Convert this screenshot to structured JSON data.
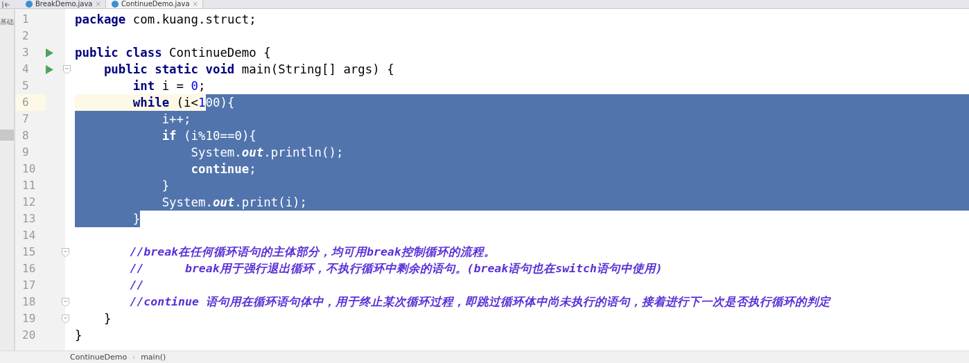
{
  "tabs": [
    {
      "label": "BreakDemo.java",
      "selected": false,
      "close": "×"
    },
    {
      "label": "ContinueDemo.java",
      "selected": true,
      "close": "×"
    }
  ],
  "project_panel": {
    "label": "基础"
  },
  "lines": [
    {
      "number": "1",
      "run": false,
      "fold": false,
      "current": false,
      "selected_to_end": false,
      "tokens": [
        {
          "text": "package",
          "kind": "kw",
          "selected": false
        },
        {
          "text": " com.kuang.struct;",
          "kind": "plain",
          "selected": false
        }
      ]
    },
    {
      "number": "2",
      "run": false,
      "fold": false,
      "current": false,
      "selected_to_end": false
    },
    {
      "number": "3",
      "run": true,
      "fold": false,
      "current": false,
      "selected_to_end": false,
      "tokens": [
        {
          "text": "public class",
          "kind": "kw",
          "selected": false
        },
        {
          "text": " ContinueDemo {",
          "kind": "plain",
          "selected": false
        }
      ]
    },
    {
      "number": "4",
      "run": true,
      "fold": true,
      "current": false,
      "selected_to_end": false,
      "tokens": [
        {
          "text": "    public static void",
          "kind": "kw",
          "selected": false
        },
        {
          "text": " main(String[] args) {",
          "kind": "plain",
          "selected": false
        }
      ]
    },
    {
      "number": "5",
      "run": false,
      "fold": false,
      "current": false,
      "selected_to_end": false,
      "tokens": [
        {
          "text": "        int",
          "kind": "kw",
          "selected": false
        },
        {
          "text": " i = ",
          "kind": "plain",
          "selected": false
        },
        {
          "text": "0",
          "kind": "num",
          "selected": false
        },
        {
          "text": ";",
          "kind": "plain",
          "selected": false
        }
      ]
    },
    {
      "number": "6",
      "run": false,
      "fold": false,
      "current": true,
      "selected_to_end": true,
      "tokens": [
        {
          "text": "        while",
          "kind": "kw",
          "selected": false
        },
        {
          "text": " (i<",
          "kind": "plain",
          "selected": false
        },
        {
          "text": "1",
          "kind": "num",
          "selected": false
        },
        {
          "text": "00",
          "kind": "num",
          "selected": true
        },
        {
          "text": "){",
          "kind": "plain",
          "selected": true
        }
      ]
    },
    {
      "number": "7",
      "run": false,
      "fold": false,
      "current": false,
      "selected_to_end": true,
      "tokens": [
        {
          "text": "            i++;",
          "kind": "plain",
          "selected": true
        }
      ]
    },
    {
      "number": "8",
      "run": false,
      "fold": false,
      "current": false,
      "selected_to_end": true,
      "tokens": [
        {
          "text": "            if",
          "kind": "kw",
          "selected": true
        },
        {
          "text": " (i%",
          "kind": "plain",
          "selected": true
        },
        {
          "text": "10",
          "kind": "num",
          "selected": true
        },
        {
          "text": "==",
          "kind": "plain",
          "selected": true
        },
        {
          "text": "0",
          "kind": "num",
          "selected": true
        },
        {
          "text": "){",
          "kind": "plain",
          "selected": true
        }
      ]
    },
    {
      "number": "9",
      "run": false,
      "fold": false,
      "current": false,
      "selected_to_end": true,
      "tokens": [
        {
          "text": "                System.",
          "kind": "plain",
          "selected": true
        },
        {
          "text": "out",
          "kind": "field",
          "selected": true
        },
        {
          "text": ".println();",
          "kind": "plain",
          "selected": true
        }
      ]
    },
    {
      "number": "10",
      "run": false,
      "fold": false,
      "current": false,
      "selected_to_end": true,
      "tokens": [
        {
          "text": "                continue",
          "kind": "kw",
          "selected": true
        },
        {
          "text": ";",
          "kind": "plain",
          "selected": true
        }
      ]
    },
    {
      "number": "11",
      "run": false,
      "fold": false,
      "current": false,
      "selected_to_end": true,
      "tokens": [
        {
          "text": "            }",
          "kind": "plain",
          "selected": true
        }
      ]
    },
    {
      "number": "12",
      "run": false,
      "fold": false,
      "current": false,
      "selected_to_end": true,
      "tokens": [
        {
          "text": "            System.",
          "kind": "plain",
          "selected": true
        },
        {
          "text": "out",
          "kind": "field",
          "selected": true
        },
        {
          "text": ".print(i);",
          "kind": "plain",
          "selected": true
        }
      ]
    },
    {
      "number": "13",
      "run": false,
      "fold": false,
      "current": false,
      "selected_to_end": false,
      "tokens": [
        {
          "text": "        }",
          "kind": "plain",
          "selected": true
        }
      ]
    },
    {
      "number": "14",
      "run": false,
      "fold": false,
      "current": false,
      "selected_to_end": false
    },
    {
      "number": "15",
      "run": false,
      "fold": true,
      "current": false,
      "selected_to_end": false,
      "tokens": [
        {
          "text": "        //break在任何循环语句的主体部分，均可用break控制循环的流程。",
          "kind": "comment",
          "selected": false
        }
      ]
    },
    {
      "number": "16",
      "run": false,
      "fold": false,
      "current": false,
      "selected_to_end": false,
      "tokens": [
        {
          "text": "        //      break用于强行退出循环，不执行循环中剩余的语句。(break语句也在switch语句中使用)",
          "kind": "comment",
          "selected": false
        }
      ]
    },
    {
      "number": "17",
      "run": false,
      "fold": false,
      "current": false,
      "selected_to_end": false,
      "tokens": [
        {
          "text": "        //",
          "kind": "comment",
          "selected": false
        }
      ]
    },
    {
      "number": "18",
      "run": false,
      "fold": true,
      "current": false,
      "selected_to_end": false,
      "tokens": [
        {
          "text": "        //continue 语句用在循环语句体中，用于终止某次循环过程，即跳过循环体中尚未执行的语句，接着进行下一次是否执行循环的判定",
          "kind": "comment",
          "selected": false
        }
      ]
    },
    {
      "number": "19",
      "run": false,
      "fold": true,
      "current": false,
      "selected_to_end": false,
      "tokens": [
        {
          "text": "    }",
          "kind": "plain",
          "selected": false
        }
      ]
    },
    {
      "number": "20",
      "run": false,
      "fold": false,
      "current": false,
      "selected_to_end": false,
      "tokens": [
        {
          "text": "}",
          "kind": "plain",
          "selected": false
        }
      ]
    }
  ],
  "breadcrumbs": {
    "items": [
      "ContinueDemo",
      "main()"
    ],
    "separator": "›"
  }
}
